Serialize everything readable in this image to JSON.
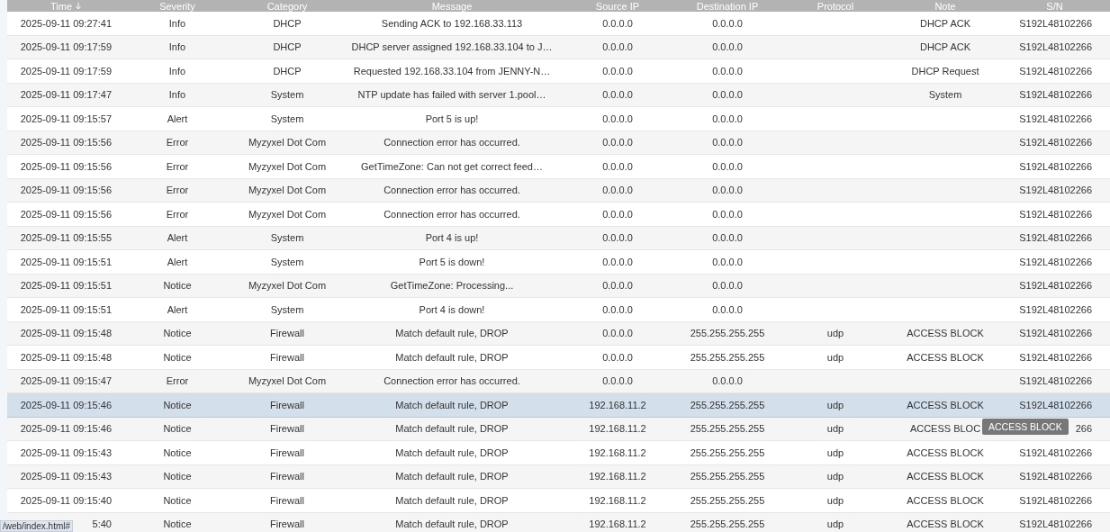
{
  "table": {
    "columns": [
      {
        "label": "Time",
        "sorted": true
      },
      {
        "label": "Severity",
        "sorted": false
      },
      {
        "label": "Category",
        "sorted": false
      },
      {
        "label": "Message",
        "sorted": false
      },
      {
        "label": "Source IP",
        "sorted": false
      },
      {
        "label": "Destination IP",
        "sorted": false
      },
      {
        "label": "Protocol",
        "sorted": false
      },
      {
        "label": "Note",
        "sorted": false
      },
      {
        "label": "S/N",
        "sorted": false
      }
    ],
    "rows": [
      {
        "time": "2025-09-11 09:27:41",
        "severity": "Info",
        "category": "DHCP",
        "message": "Sending ACK to 192.168.33.113",
        "source_ip": "0.0.0.0",
        "destination_ip": "0.0.0.0",
        "note": "DHCP ACK",
        "sn": "S192L48102266",
        "hovered": false
      },
      {
        "time": "2025-09-11 09:17:59",
        "severity": "Info",
        "category": "DHCP",
        "message": "DHCP server assigned 192.168.33.104 to J…",
        "source_ip": "0.0.0.0",
        "destination_ip": "0.0.0.0",
        "note": "DHCP ACK",
        "sn": "S192L48102266",
        "hovered": false
      },
      {
        "time": "2025-09-11 09:17:59",
        "severity": "Info",
        "category": "DHCP",
        "message": "Requested 192.168.33.104 from JENNY-N…",
        "source_ip": "0.0.0.0",
        "destination_ip": "0.0.0.0",
        "note": "DHCP Request",
        "sn": "S192L48102266",
        "hovered": false
      },
      {
        "time": "2025-09-11 09:17:47",
        "severity": "Info",
        "category": "System",
        "message": "NTP update has failed with server 1.pool…",
        "source_ip": "0.0.0.0",
        "destination_ip": "0.0.0.0",
        "note": "System",
        "sn": "S192L48102266",
        "hovered": false
      },
      {
        "time": "2025-09-11 09:15:57",
        "severity": "Alert",
        "category": "System",
        "message": "Port 5 is up!",
        "source_ip": "0.0.0.0",
        "destination_ip": "0.0.0.0",
        "sn": "S192L48102266",
        "hovered": false
      },
      {
        "time": "2025-09-11 09:15:56",
        "severity": "Error",
        "category": "Myzyxel Dot Com",
        "message": "Connection error has occurred.",
        "source_ip": "0.0.0.0",
        "destination_ip": "0.0.0.0",
        "sn": "S192L48102266",
        "hovered": false
      },
      {
        "time": "2025-09-11 09:15:56",
        "severity": "Error",
        "category": "Myzyxel Dot Com",
        "message": "GetTimeZone: Can not get correct feed…",
        "source_ip": "0.0.0.0",
        "destination_ip": "0.0.0.0",
        "sn": "S192L48102266",
        "hovered": false
      },
      {
        "time": "2025-09-11 09:15:56",
        "severity": "Error",
        "category": "Myzyxel Dot Com",
        "message": "Connection error has occurred.",
        "source_ip": "0.0.0.0",
        "destination_ip": "0.0.0.0",
        "sn": "S192L48102266",
        "hovered": false
      },
      {
        "time": "2025-09-11 09:15:56",
        "severity": "Error",
        "category": "Myzyxel Dot Com",
        "message": "Connection error has occurred.",
        "source_ip": "0.0.0.0",
        "destination_ip": "0.0.0.0",
        "sn": "S192L48102266",
        "hovered": false
      },
      {
        "time": "2025-09-11 09:15:55",
        "severity": "Alert",
        "category": "System",
        "message": "Port 4 is up!",
        "source_ip": "0.0.0.0",
        "destination_ip": "0.0.0.0",
        "sn": "S192L48102266",
        "hovered": false
      },
      {
        "time": "2025-09-11 09:15:51",
        "severity": "Alert",
        "category": "System",
        "message": "Port 5 is down!",
        "source_ip": "0.0.0.0",
        "destination_ip": "0.0.0.0",
        "sn": "S192L48102266",
        "hovered": false
      },
      {
        "time": "2025-09-11 09:15:51",
        "severity": "Notice",
        "category": "Myzyxel Dot Com",
        "message": "GetTimeZone: Processing...",
        "source_ip": "0.0.0.0",
        "destination_ip": "0.0.0.0",
        "sn": "S192L48102266",
        "hovered": false
      },
      {
        "time": "2025-09-11 09:15:51",
        "severity": "Alert",
        "category": "System",
        "message": "Port 4 is down!",
        "source_ip": "0.0.0.0",
        "destination_ip": "0.0.0.0",
        "sn": "S192L48102266",
        "hovered": false
      },
      {
        "time": "2025-09-11 09:15:48",
        "severity": "Notice",
        "category": "Firewall",
        "message": "Match default rule, DROP",
        "source_ip": "0.0.0.0",
        "destination_ip": "255.255.255.255",
        "protocol": "udp",
        "note": "ACCESS BLOCK",
        "sn": "S192L48102266",
        "hovered": false
      },
      {
        "time": "2025-09-11 09:15:48",
        "severity": "Notice",
        "category": "Firewall",
        "message": "Match default rule, DROP",
        "source_ip": "0.0.0.0",
        "destination_ip": "255.255.255.255",
        "protocol": "udp",
        "note": "ACCESS BLOCK",
        "sn": "S192L48102266",
        "hovered": false
      },
      {
        "time": "2025-09-11 09:15:47",
        "severity": "Error",
        "category": "Myzyxel Dot Com",
        "message": "Connection error has occurred.",
        "source_ip": "0.0.0.0",
        "destination_ip": "0.0.0.0",
        "sn": "S192L48102266",
        "hovered": false
      },
      {
        "time": "2025-09-11 09:15:46",
        "severity": "Notice",
        "category": "Firewall",
        "message": "Match default rule, DROP",
        "source_ip": "192.168.11.2",
        "destination_ip": "255.255.255.255",
        "protocol": "udp",
        "note": "ACCESS BLOCK",
        "sn": "S192L48102266",
        "hovered": true
      },
      {
        "time": "2025-09-11 09:15:46",
        "severity": "Notice",
        "category": "Firewall",
        "message": "Match default rule, DROP",
        "source_ip": "192.168.11.2",
        "destination_ip": "255.255.255.255",
        "protocol": "udp",
        "note": "ACCESS BLOC",
        "sn": "266",
        "hovered": false,
        "tooltip": "ACCESS BLOCK"
      },
      {
        "time": "2025-09-11 09:15:43",
        "severity": "Notice",
        "category": "Firewall",
        "message": "Match default rule, DROP",
        "source_ip": "192.168.11.2",
        "destination_ip": "255.255.255.255",
        "protocol": "udp",
        "note": "ACCESS BLOCK",
        "sn": "S192L48102266",
        "hovered": false
      },
      {
        "time": "2025-09-11 09:15:43",
        "severity": "Notice",
        "category": "Firewall",
        "message": "Match default rule, DROP",
        "source_ip": "192.168.11.2",
        "destination_ip": "255.255.255.255",
        "protocol": "udp",
        "note": "ACCESS BLOCK",
        "sn": "S192L48102266",
        "hovered": false
      },
      {
        "time": "2025-09-11 09:15:40",
        "severity": "Notice",
        "category": "Firewall",
        "message": "Match default rule, DROP",
        "source_ip": "192.168.11.2",
        "destination_ip": "255.255.255.255",
        "protocol": "udp",
        "note": "ACCESS BLOCK",
        "sn": "S192L48102266",
        "hovered": false
      },
      {
        "time": "5:40",
        "severity": "Notice",
        "category": "Firewall",
        "message": "Match default rule, DROP",
        "source_ip": "192.168.11.2",
        "destination_ip": "255.255.255.255",
        "protocol": "udp",
        "note": "ACCESS BLOCK",
        "sn": "S192L48102266",
        "hovered": false
      }
    ]
  },
  "status_bar": {
    "url": "/web/index.html#"
  }
}
